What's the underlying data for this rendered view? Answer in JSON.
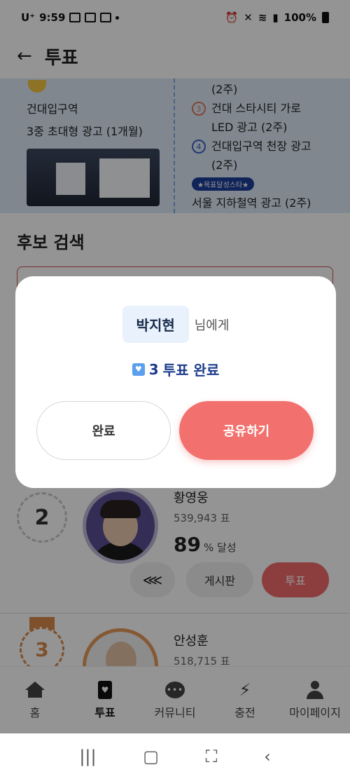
{
  "status_bar": {
    "carrier": "U⁺",
    "time": "9:59",
    "battery": "100%"
  },
  "header": {
    "title": "투표"
  },
  "banner": {
    "left_line1": "건대입구역",
    "left_line2": "3중 초대형 광고 (1개월)",
    "right_items": [
      {
        "num": "",
        "text": "(2주)"
      },
      {
        "num": "3",
        "text": "건대 스타시티 가로"
      },
      {
        "num": "",
        "text": "LED 광고 (2주)"
      },
      {
        "num": "4",
        "text": "건대입구역 천장 광고"
      },
      {
        "num": "",
        "text": "(2주)"
      }
    ],
    "star_badge": "★목표달성스타★",
    "star_item": "서울 지하철역 광고 (2주)"
  },
  "search": {
    "title": "후보 검색"
  },
  "candidates": [
    {
      "rank": "2",
      "name": "황영웅",
      "votes": "539,943 표",
      "percent": "89",
      "percent_suffix": "% 달성",
      "board": "게시판",
      "vote": "투표"
    },
    {
      "rank": "3",
      "name": "안성훈",
      "votes": "518,715 표"
    }
  ],
  "bottom_nav": {
    "items": [
      "홈",
      "투표",
      "커뮤니티",
      "충전",
      "마이페이지"
    ]
  },
  "modal": {
    "name": "박지현",
    "suffix": "님에게",
    "vote_count": "3",
    "vote_done": "투표 완료",
    "complete_button": "완료",
    "share_button": "공유하기"
  },
  "colors": {
    "accent": "#f2716f",
    "navy": "#1d3c8c",
    "banner_bg": "#dde9f7"
  },
  "icons": [
    "back-arrow-icon",
    "share-icon",
    "home-icon",
    "vote-card-icon",
    "chat-icon",
    "bolt-icon",
    "user-icon",
    "heart-icon"
  ]
}
